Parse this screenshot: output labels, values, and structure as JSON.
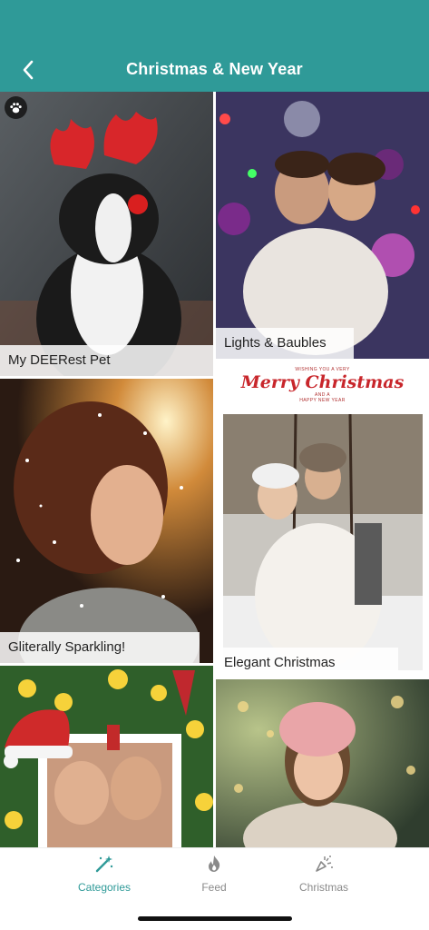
{
  "header": {
    "title": "Christmas & New Year",
    "background": "#2f9a98"
  },
  "tiles": [
    {
      "label": "My DEERest Pet",
      "badge_icon": "paw-icon"
    },
    {
      "label": "Lights & Baubles"
    },
    {
      "label": "Gliterally Sparkling!"
    },
    {
      "label": "Elegant Christmas",
      "card_text": {
        "top_line": "WISHING YOU A VERY",
        "script": "Merry Christmas",
        "and": "AND A",
        "bottom_line": "HAPPY NEW YEAR"
      }
    },
    {
      "label": ""
    },
    {
      "label": ""
    }
  ],
  "tabbar": {
    "items": [
      {
        "label": "Categories",
        "icon": "magic-wand-icon",
        "active": true
      },
      {
        "label": "Feed",
        "icon": "flame-icon",
        "active": false
      },
      {
        "label": "Christmas",
        "icon": "party-popper-icon",
        "active": false
      }
    ],
    "active_color": "#2f9a98",
    "inactive_color": "#8a8a8a"
  }
}
